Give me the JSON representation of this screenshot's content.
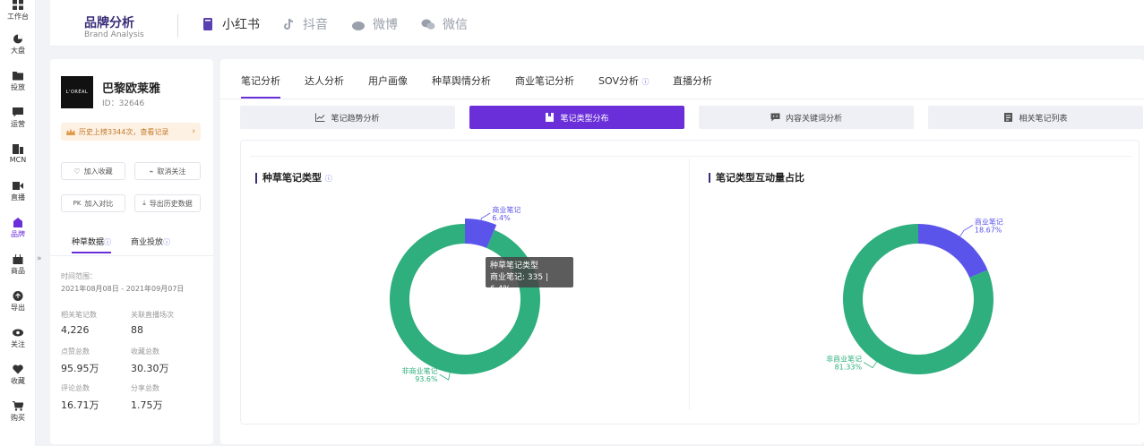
{
  "rail": {
    "items": [
      {
        "label": "工作台",
        "icon": "grid-icon"
      },
      {
        "label": "大盘",
        "icon": "pie-icon"
      },
      {
        "label": "投放",
        "icon": "folder-icon"
      },
      {
        "label": "运营",
        "icon": "chat-icon"
      },
      {
        "label": "MCN",
        "icon": "mcn-icon"
      },
      {
        "label": "直播",
        "icon": "video-icon"
      },
      {
        "label": "品牌",
        "icon": "brand-icon"
      },
      {
        "label": "商品",
        "icon": "bag-icon"
      },
      {
        "label": "导出",
        "icon": "upload-icon"
      },
      {
        "label": "关注",
        "icon": "eye-icon"
      },
      {
        "label": "收藏",
        "icon": "heart-icon"
      },
      {
        "label": "购买",
        "icon": "cart-icon"
      }
    ],
    "expand": "»"
  },
  "header": {
    "title": "品牌分析",
    "subtitle": "Brand Analysis",
    "platforms": [
      {
        "label": "小红书",
        "icon": "xiaohongshu-icon",
        "active": true
      },
      {
        "label": "抖音",
        "icon": "douyin-icon",
        "active": false
      },
      {
        "label": "微博",
        "icon": "weibo-icon",
        "active": false
      },
      {
        "label": "微信",
        "icon": "wechat-icon",
        "active": false
      }
    ]
  },
  "brand": {
    "logo_text": "L'ORÉAL",
    "name": "巴黎欧莱雅",
    "id": "ID：32646",
    "history": "历史上榜3344次，查看记录",
    "buttons": {
      "add_fav": "加入收藏",
      "unfollow": "取消关注",
      "compare": "加入对比",
      "compare_prefix": "PK",
      "export": "导出历史数据"
    },
    "subtabs": {
      "grass": "种草数据",
      "commercial": "商业投放"
    },
    "range_label": "时间范围：",
    "range_value": "2021年08月08日 - 2021年09月07日",
    "stats": [
      {
        "label": "相关笔记数",
        "value": "4,226"
      },
      {
        "label": "关联直播场次",
        "value": "88"
      },
      {
        "label": "点赞总数",
        "value": "95.95万"
      },
      {
        "label": "收藏总数",
        "value": "30.30万"
      },
      {
        "label": "评论总数",
        "value": "16.71万"
      },
      {
        "label": "分享总数",
        "value": "1.75万"
      }
    ]
  },
  "main": {
    "tabs": [
      "笔记分析",
      "达人分析",
      "用户画像",
      "种草舆情分析",
      "商业笔记分析",
      "SOV分析",
      "直播分析"
    ],
    "subbuttons": [
      {
        "label": "笔记趋势分析",
        "icon": "trend-icon",
        "active": false
      },
      {
        "label": "笔记类型分布",
        "icon": "bookmark-icon",
        "active": true
      },
      {
        "label": "内容关键词分析",
        "icon": "comment-icon",
        "active": false
      },
      {
        "label": "相关笔记列表",
        "icon": "list-icon",
        "active": false
      }
    ],
    "tooltip": {
      "title": "种草笔记类型",
      "body": "商业笔记: 335 | 6.4%"
    }
  },
  "chart_data": [
    {
      "type": "pie",
      "title": "种草笔记类型",
      "categories": [
        "商业笔记",
        "非商业笔记"
      ],
      "values": [
        6.4,
        93.6
      ],
      "value_labels": [
        "6.4%",
        "93.6%"
      ],
      "colors": [
        "#5b54ea",
        "#2fae7e"
      ],
      "donut": true
    },
    {
      "type": "pie",
      "title": "笔记类型互动量占比",
      "categories": [
        "商业笔记",
        "非商业笔记"
      ],
      "values": [
        18.67,
        81.33
      ],
      "value_labels": [
        "18.67%",
        "81.33%"
      ],
      "colors": [
        "#5b54ea",
        "#2fae7e"
      ],
      "donut": true
    }
  ]
}
